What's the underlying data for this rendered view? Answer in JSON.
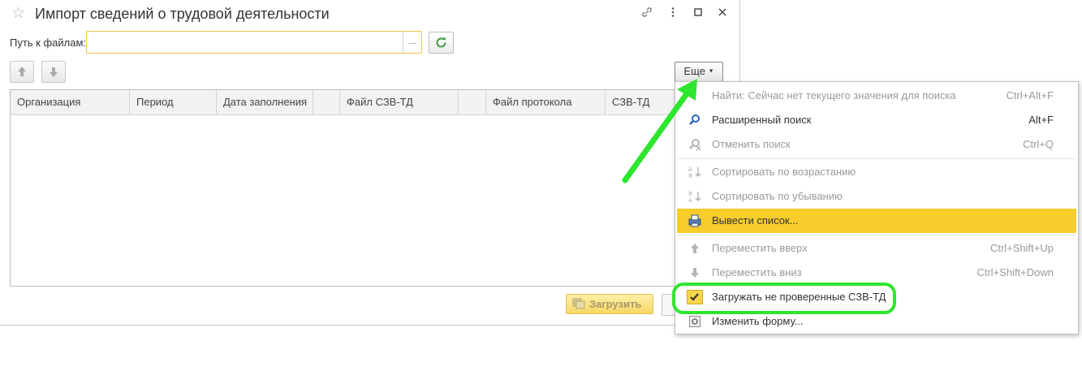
{
  "window": {
    "title": "Импорт сведений о трудовой деятельности",
    "title_buttons": [
      "link-icon",
      "more-vertical-icon",
      "maximize-icon",
      "close-icon"
    ]
  },
  "path_field": {
    "label": "Путь к файлам:",
    "value": "",
    "select_button": "..."
  },
  "toolbar": {
    "more_label": "Еще"
  },
  "table": {
    "columns": [
      "Организация",
      "Период",
      "Дата заполнения",
      "",
      "Файл СЗВ-ТД",
      "",
      "Файл протокола",
      "СЗВ-ТД"
    ],
    "rows": []
  },
  "footer": {
    "load_label": "Загрузить"
  },
  "menu": {
    "items": [
      {
        "label": "Найти: Сейчас нет текущего значения для поиска",
        "shortcut": "Ctrl+Alt+F",
        "enabled": false,
        "icon": "none"
      },
      {
        "label": "Расширенный поиск",
        "shortcut": "Alt+F",
        "enabled": true,
        "icon": "search-icon"
      },
      {
        "label": "Отменить поиск",
        "shortcut": "Ctrl+Q",
        "enabled": false,
        "icon": "cancel-search-icon"
      },
      {
        "label": "Сортировать по возрастанию",
        "shortcut": "",
        "enabled": false,
        "icon": "sort-asc-icon"
      },
      {
        "label": "Сортировать по убыванию",
        "shortcut": "",
        "enabled": false,
        "icon": "sort-desc-icon"
      },
      {
        "label": "Вывести список...",
        "shortcut": "",
        "enabled": true,
        "icon": "print-list-icon",
        "highlighted": true
      },
      {
        "label": "Переместить вверх",
        "shortcut": "Ctrl+Shift+Up",
        "enabled": false,
        "icon": "arrow-up-icon"
      },
      {
        "label": "Переместить вниз",
        "shortcut": "Ctrl+Shift+Down",
        "enabled": false,
        "icon": "arrow-down-icon"
      },
      {
        "label": "Загружать не проверенные СЗВ-ТД",
        "shortcut": "",
        "enabled": true,
        "icon": "checkmark-icon",
        "checked": true
      },
      {
        "label": "Изменить форму...",
        "shortcut": "",
        "enabled": true,
        "icon": "form-settings-icon"
      }
    ]
  },
  "colors": {
    "highlight": "#f8cc2b",
    "annotation_green": "#2ee52e",
    "field_border": "#f0c24a",
    "refresh_green": "#3f9a3f"
  }
}
